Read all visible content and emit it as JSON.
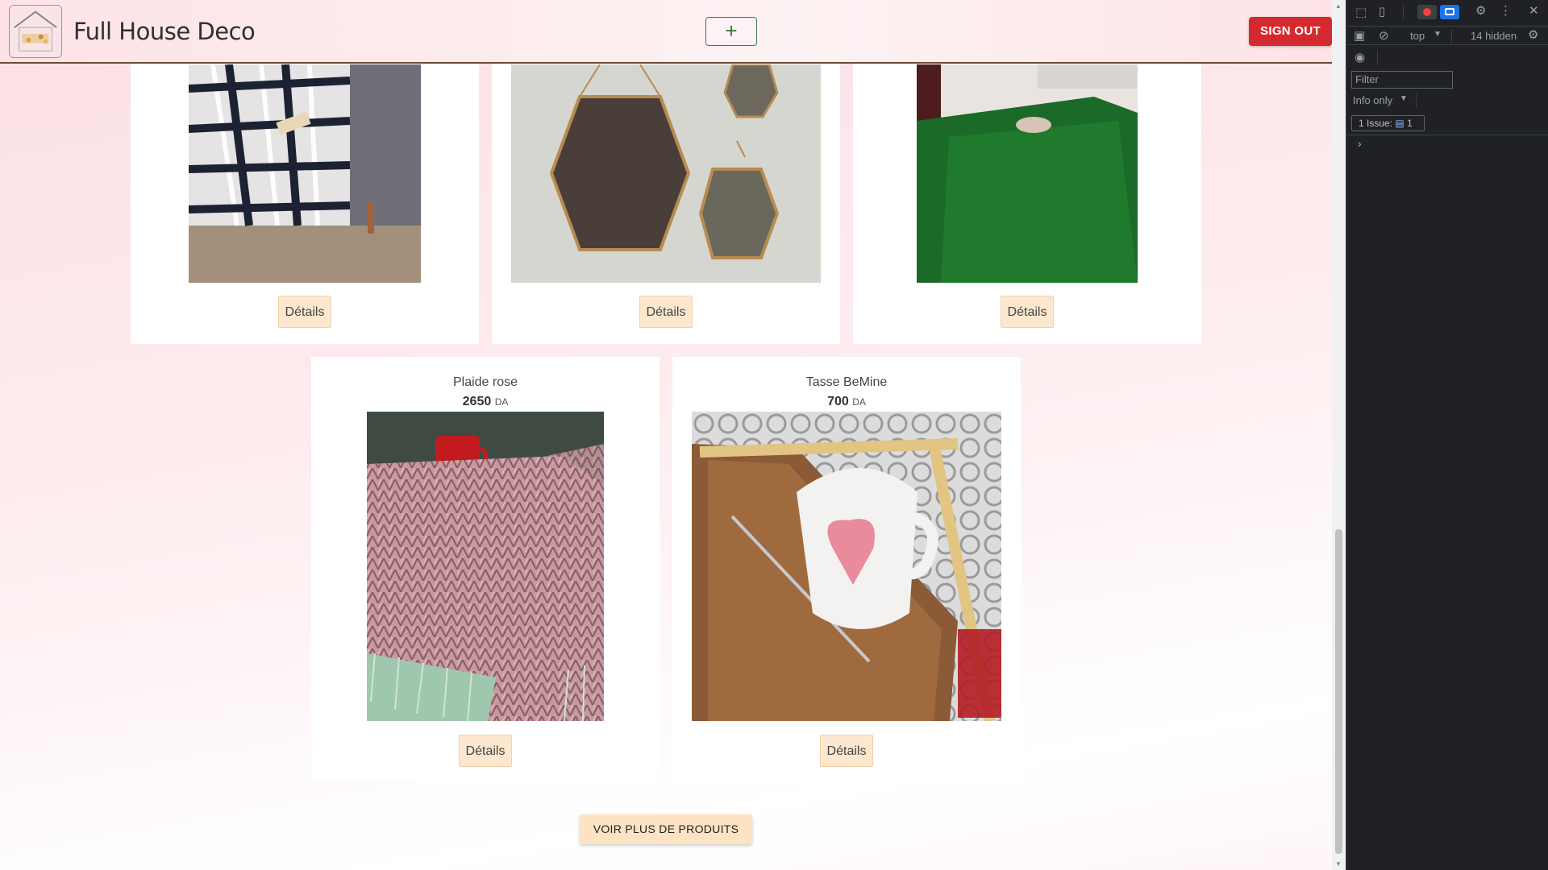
{
  "header": {
    "brand": "Full House Deco",
    "add_label": "+",
    "signout_label": "SIGN OUT"
  },
  "products_top": [
    {
      "details_label": "Détails"
    },
    {
      "details_label": "Détails"
    },
    {
      "details_label": "Détails"
    }
  ],
  "products_bottom": [
    {
      "name": "Plaide rose",
      "price": "2650",
      "currency": "DA",
      "details_label": "Détails"
    },
    {
      "name": "Tasse BeMine",
      "price": "700",
      "currency": "DA",
      "details_label": "Détails"
    }
  ],
  "more_button": "VOIR PLUS DE PRODUITS",
  "devtools": {
    "context": "top",
    "hidden_count": "14 hidden",
    "filter_placeholder": "Filter",
    "level": "Info only",
    "issues_label": "1 Issue:",
    "issues_count": "1"
  },
  "colors": {
    "signout": "#d42a2f",
    "details_bg": "#fde8cf",
    "add_border": "#3e7a45"
  }
}
